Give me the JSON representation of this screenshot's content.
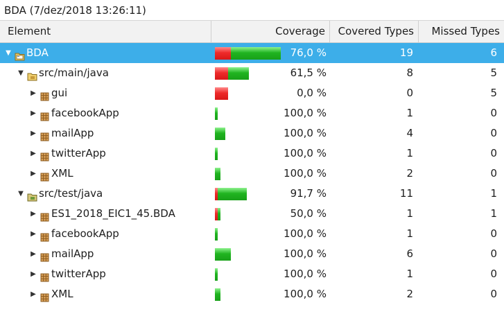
{
  "title": "BDA (7/dez/2018 13:26:11)",
  "columns": {
    "element": "Element",
    "coverage": "Coverage",
    "covered": "Covered Types",
    "missed": "Missed Types"
  },
  "colors": {
    "selection": "#3daee9",
    "missed_bar": "#e32424",
    "covered_bar": "#22b422"
  },
  "rows": [
    {
      "name": "BDA",
      "level": 0,
      "expanded": true,
      "icon": "project-icon",
      "coverage": "76,0 %",
      "covered": "19",
      "missed": "6",
      "selected": true,
      "covered_fraction": 0.76,
      "types_total": 25
    },
    {
      "name": "src/main/java",
      "level": 1,
      "expanded": true,
      "icon": "source-folder-icon",
      "coverage": "61,5 %",
      "covered": "8",
      "missed": "5",
      "covered_fraction": 0.615,
      "types_total": 13
    },
    {
      "name": "gui",
      "level": 2,
      "expanded": false,
      "icon": "package-icon",
      "coverage": "0,0 %",
      "covered": "0",
      "missed": "5",
      "covered_fraction": 0.0,
      "types_total": 5
    },
    {
      "name": "facebookApp",
      "level": 2,
      "expanded": false,
      "icon": "package-icon",
      "coverage": "100,0 %",
      "covered": "1",
      "missed": "0",
      "covered_fraction": 1.0,
      "types_total": 1
    },
    {
      "name": "mailApp",
      "level": 2,
      "expanded": false,
      "icon": "package-icon",
      "coverage": "100,0 %",
      "covered": "4",
      "missed": "0",
      "covered_fraction": 1.0,
      "types_total": 4
    },
    {
      "name": "twitterApp",
      "level": 2,
      "expanded": false,
      "icon": "package-icon",
      "coverage": "100,0 %",
      "covered": "1",
      "missed": "0",
      "covered_fraction": 1.0,
      "types_total": 1
    },
    {
      "name": "XML",
      "level": 2,
      "expanded": false,
      "icon": "package-icon",
      "coverage": "100,0 %",
      "covered": "2",
      "missed": "0",
      "covered_fraction": 1.0,
      "types_total": 2
    },
    {
      "name": "src/test/java",
      "level": 1,
      "expanded": true,
      "icon": "test-source-folder-icon",
      "coverage": "91,7 %",
      "covered": "11",
      "missed": "1",
      "covered_fraction": 0.917,
      "types_total": 12
    },
    {
      "name": "ES1_2018_EIC1_45.BDA",
      "level": 2,
      "expanded": false,
      "icon": "package-icon",
      "coverage": "50,0 %",
      "covered": "1",
      "missed": "1",
      "covered_fraction": 0.5,
      "types_total": 2
    },
    {
      "name": "facebookApp",
      "level": 2,
      "expanded": false,
      "icon": "package-icon",
      "coverage": "100,0 %",
      "covered": "1",
      "missed": "0",
      "covered_fraction": 1.0,
      "types_total": 1
    },
    {
      "name": "mailApp",
      "level": 2,
      "expanded": false,
      "icon": "package-icon",
      "coverage": "100,0 %",
      "covered": "6",
      "missed": "0",
      "covered_fraction": 1.0,
      "types_total": 6
    },
    {
      "name": "twitterApp",
      "level": 2,
      "expanded": false,
      "icon": "package-icon",
      "coverage": "100,0 %",
      "covered": "1",
      "missed": "0",
      "covered_fraction": 1.0,
      "types_total": 1
    },
    {
      "name": "XML",
      "level": 2,
      "expanded": false,
      "icon": "package-icon",
      "coverage": "100,0 %",
      "covered": "2",
      "missed": "0",
      "covered_fraction": 1.0,
      "types_total": 2
    }
  ]
}
